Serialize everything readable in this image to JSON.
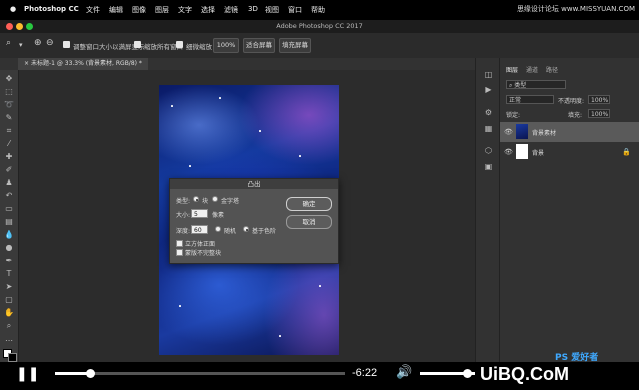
{
  "menubar": {
    "apple": "",
    "items": [
      "Photoshop CC",
      "文件",
      "编辑",
      "图像",
      "图层",
      "文字",
      "选择",
      "滤镜",
      "3D",
      "视图",
      "窗口",
      "帮助"
    ],
    "watermark": "思缘设计论坛 www.MISSYUAN.COM"
  },
  "window": {
    "title": "Adobe Photoshop CC 2017"
  },
  "options": {
    "resize_window": "调整窗口大小以满屏显示",
    "zoom_all": "缩放所有窗口",
    "scrubby_zoom": "细微缩放",
    "zoom_value": "100%",
    "fit_screen": "适合屏幕",
    "fill_screen": "填充屏幕"
  },
  "tab": {
    "doc": "未标题-1 @ 33.3% (背景素材, RGB/8) *",
    "close": "×"
  },
  "dialog": {
    "title": "凸出",
    "type_label": "类型:",
    "type_block": "块",
    "type_pyramid": "金字塔",
    "size_label": "大小:",
    "size_value": "5",
    "size_unit": "像素",
    "depth_label": "深度:",
    "depth_value": "60",
    "depth_random": "随机",
    "depth_level": "基于色阶",
    "solid_faces": "立方体正面",
    "mask_incomplete": "蒙版不完整块",
    "ok": "确定",
    "cancel": "取消"
  },
  "layers_panel": {
    "tabs": [
      "图层",
      "通道",
      "路径"
    ],
    "filter_kind": "类型",
    "blend_mode": "正常",
    "opacity_label": "不透明度:",
    "opacity_value": "100%",
    "lock_label": "锁定:",
    "fill_label": "填充:",
    "fill_value": "100%",
    "layers": [
      {
        "name": "背景素材"
      },
      {
        "name": "背景"
      }
    ]
  },
  "player": {
    "time_remaining": "-6:22",
    "progress_fraction": 0.12,
    "volume_fraction": 0.85,
    "logo_text": "UiBQ.CoM",
    "logo_sub": "PS 爱好者"
  },
  "colors": {
    "accent": "#0a5dbf",
    "canvas_bg": "#2c2c2c",
    "panel_bg": "#323232"
  }
}
